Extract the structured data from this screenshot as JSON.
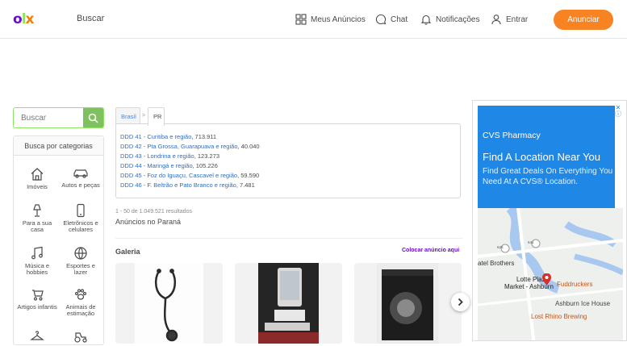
{
  "header": {
    "logo": {
      "o": "o",
      "l": "l",
      "x": "x"
    },
    "search_label": "Buscar",
    "nav": [
      {
        "label": "Meus Anúncios",
        "icon": "grid-icon"
      },
      {
        "label": "Chat",
        "icon": "chat-icon"
      },
      {
        "label": "Notificações",
        "icon": "bell-icon"
      },
      {
        "label": "Entrar",
        "icon": "user-icon"
      }
    ],
    "cta": "Anunciar"
  },
  "sidebar": {
    "search_placeholder": "Buscar",
    "categories_title": "Busca por categorias",
    "categories": [
      {
        "label": "Imóveis",
        "icon": "house-icon"
      },
      {
        "label": "Autos e peças",
        "icon": "car-icon"
      },
      {
        "label": "Para a sua casa",
        "icon": "lamp-icon"
      },
      {
        "label": "Eletrônicos e celulares",
        "icon": "phone-icon"
      },
      {
        "label": "Música e hobbies",
        "icon": "music-icon"
      },
      {
        "label": "Esportes e lazer",
        "icon": "ball-icon"
      },
      {
        "label": "Artigos infantis",
        "icon": "stroller-icon"
      },
      {
        "label": "Animais de estimação",
        "icon": "paw-icon"
      },
      {
        "label": "",
        "icon": "hanger-icon"
      },
      {
        "label": "",
        "icon": "tractor-icon"
      }
    ]
  },
  "breadcrumb": [
    "Brasil",
    "PR"
  ],
  "breadcrumb_separator": ">",
  "ddd_list": [
    {
      "link": "DDD 41 - Curitiba e região",
      "count": ", 713.911"
    },
    {
      "link": "DDD 42 - Pta Grossa, Guarapuava e região",
      "count": ", 40.040"
    },
    {
      "link": "DDD 43 - Londrina e região",
      "count": ", 123.273"
    },
    {
      "link": "DDD 44 - Maringá e região",
      "count": ", 105.226"
    },
    {
      "link": "DDD 45 - Foz do Iguaçu, Cascavel e região",
      "count": ", 59.590"
    },
    {
      "link": "DDD 46 - F. Beltrão e Pato Branco e região",
      "count": ", 7.481"
    }
  ],
  "results_text": "1 - 50 de 1.049.521 resultados",
  "ads_title": "Anúncios no Paraná",
  "gallery": {
    "title": "Galeria",
    "link": "Colocar anúncio aqui",
    "items": [
      {
        "image": "stethoscope-image"
      },
      {
        "image": "tablet-display-image"
      },
      {
        "image": "boxed-device-image"
      }
    ]
  },
  "ad": {
    "brand": "CVS Pharmacy",
    "headline": "Find A Location Near You",
    "sub": "Find Great Deals On Everything You Need At A CVS® Location.",
    "map_labels": [
      "atel Brothers",
      "Lotte Plaza",
      "Market - Ashburn",
      "Fuddruckers",
      "Ashburn Ice House",
      "Lost Rhino Brewing"
    ],
    "route_numbers": [
      "641",
      "625"
    ],
    "colors": {
      "bg": "#1f87e5"
    }
  },
  "colors": {
    "purple": "#6e0ad6",
    "orange": "#f78323",
    "green": "#8ce563"
  }
}
